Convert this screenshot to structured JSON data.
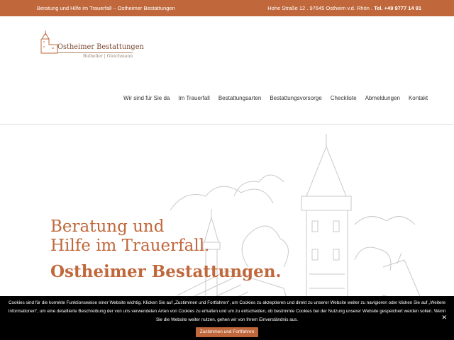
{
  "topbar": {
    "left_text": "Beratung und Hilfe im Trauerfall – Ostheimer Bestattungen",
    "address": "Hohe Straße 12 . 97645 Ostheim v.d. Rhön .",
    "phone": "Tel. +49 9777 14 91"
  },
  "logo": {
    "brand": "Ostheimer Bestattungen",
    "sub": "Bulheller | Gleichmann"
  },
  "nav": {
    "items": [
      "Wir sind für Sie da",
      "Im Trauerfall",
      "Bestattungsarten",
      "Bestattungsvorsorge",
      "Checkliste",
      "Abmeldungen",
      "Kontakt"
    ]
  },
  "hero": {
    "line1": "Beratung und",
    "line2": "Hilfe im Trauerfall.",
    "line3": "Ostheimer Bestattungen."
  },
  "cookie": {
    "text": "Cookies sind für die korrekte Funktionsweise einer Website wichtig. Klicken Sie auf „Zustimmen und Fortfahren“, um Cookies zu akzeptieren und direkt zu unserer Website weiter zu navigieren oder klicken Sie auf „Weitere Informationen“, um eine detaillierte Beschreibung der von uns verwendeten Arten von Cookies zu erhalten und um zu entscheiden, ob bestimmte Cookies bei der Nutzung unserer Website gespeichert werden sollen. Wenn Sie die Website weiter nutzen, gehen wir von Ihrem Einverständnis aus.",
    "accept_label": "Zustimmen und Fortfahren",
    "close_label": "✕"
  },
  "colors": {
    "accent": "#c0673b",
    "cookie_bg": "#000000"
  }
}
